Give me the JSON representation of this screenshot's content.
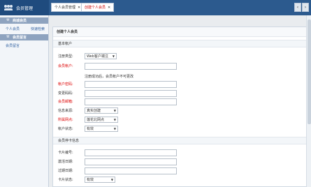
{
  "app": {
    "title": "会员管理",
    "icon": "users-icon"
  },
  "sidebar": {
    "group1": {
      "label": "商城会员",
      "icon": "wrench-icon"
    },
    "links": [
      {
        "label": "个人会员"
      },
      {
        "label": "快速检索"
      }
    ],
    "group2": {
      "label": "会员留言",
      "icon": "wrench-icon"
    },
    "link2": {
      "label": "会员留言"
    }
  },
  "tabs": [
    {
      "label": "个人会员管理",
      "close": "✕",
      "active": false
    },
    {
      "label": "创建个人会员",
      "close": "✕",
      "active": true
    }
  ],
  "tab_scroll": {
    "prev": "‹",
    "next": "›"
  },
  "form": {
    "title": "创建个人会员",
    "basic_section": "基本帐户",
    "fields": {
      "reg_type": {
        "label": "注册类型:",
        "value": "Web客户端注"
      },
      "account": {
        "label": "会员帐户:",
        "value": ""
      },
      "hint": "注册成功后，会员帐户不可更改",
      "password": {
        "label": "帐户密码:",
        "value": ""
      },
      "password_confirm": {
        "label": "变更码码:",
        "value": ""
      },
      "email": {
        "label": "会员邮箱:",
        "value": ""
      },
      "source": {
        "label": "信息来源:",
        "value": "真实创建"
      },
      "outlet": {
        "label": "所属网点:",
        "value": "莲花北网点"
      },
      "status": {
        "label": "帐户状态:",
        "value": "有效"
      }
    },
    "card_section": "会员停卡信息",
    "card_fields": {
      "card_no": {
        "label": "卡片编号:",
        "value": ""
      },
      "activate_date": {
        "label": "激活日期:",
        "value": ""
      },
      "expire_date": {
        "label": "过期日期:",
        "value": ""
      },
      "card_status": {
        "label": "卡片状态:",
        "value": "有效"
      }
    }
  }
}
